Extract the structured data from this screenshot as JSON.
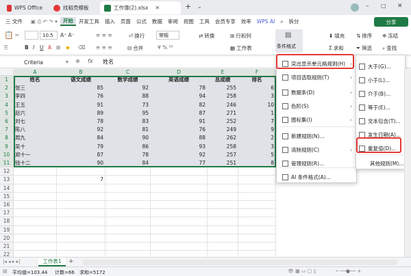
{
  "titlebar": {
    "tabs": [
      {
        "label": "WPS Office"
      },
      {
        "label": "找稻壳模板"
      },
      {
        "label": "工作簿(2).xlsx"
      }
    ],
    "new_tab": "+"
  },
  "menubar": {
    "file": "三 文件",
    "items": [
      "开始",
      "开发工具",
      "插入",
      "页面",
      "公式",
      "数据",
      "审阅",
      "视图",
      "工具",
      "会员专享",
      "效率"
    ],
    "wps_ai": "WPS AI",
    "split": "拆分",
    "share": "分享"
  },
  "ribbon": {
    "font_size": "10.5",
    "wrap": "换行",
    "merge": "合并",
    "number_format": "常规",
    "convert": "转换",
    "row_col": "行和列",
    "worksheet": "工作表",
    "cond_format": "条件格式",
    "fill": "填充",
    "sum": "求和",
    "sort": "排序",
    "filter": "筛选",
    "freeze": "冻结",
    "find": "查找"
  },
  "formula_bar": {
    "name_box": "Criteria",
    "fx": "fx",
    "value": "姓名"
  },
  "grid": {
    "columns": [
      "A",
      "B",
      "C",
      "D",
      "E",
      "F",
      "G"
    ],
    "headers": [
      "姓名",
      "语文成绩",
      "数学成绩",
      "英语成绩",
      "总成绩",
      "排名"
    ],
    "rows": [
      [
        "张三",
        "85",
        "92",
        "78",
        "255",
        "6"
      ],
      [
        "李四",
        "76",
        "88",
        "94",
        "258",
        "3"
      ],
      [
        "王五",
        "91",
        "73",
        "82",
        "246",
        "10"
      ],
      [
        "赵六",
        "89",
        "95",
        "87",
        "271",
        "1"
      ],
      [
        "刘七",
        "78",
        "83",
        "91",
        "252",
        "7"
      ],
      [
        "陈八",
        "92",
        "81",
        "76",
        "249",
        "9"
      ],
      [
        "周九",
        "84",
        "90",
        "88",
        "262",
        "2"
      ],
      [
        "吴十",
        "79",
        "86",
        "93",
        "258",
        "3"
      ],
      [
        "郑十一",
        "87",
        "78",
        "92",
        "257",
        "5"
      ],
      [
        "钱十二",
        "90",
        "84",
        "77",
        "251",
        "8"
      ]
    ],
    "row_numbers": [
      "1",
      "2",
      "3",
      "4",
      "5",
      "6",
      "7",
      "8",
      "9",
      "10",
      "11",
      "12",
      "13",
      "14",
      "15",
      "16",
      "17",
      "18",
      "19",
      "20",
      "21",
      "22"
    ],
    "b13_value": "7"
  },
  "cond_menu": {
    "items": [
      {
        "label": "突出显示单元格规则(H)",
        "submenu": true
      },
      {
        "label": "项目选取规则(T)",
        "submenu": true
      },
      {
        "label": "数据条(D)",
        "submenu": true
      },
      {
        "label": "色阶(S)",
        "submenu": true
      },
      {
        "label": "图标集(I)",
        "submenu": true
      },
      {
        "label": "新建规则(N)...",
        "submenu": false
      },
      {
        "label": "清除规则(C)",
        "submenu": true
      },
      {
        "label": "管理规则(R)...",
        "submenu": false
      },
      {
        "label": "AI 条件格式(A)...",
        "submenu": false
      }
    ]
  },
  "highlight_menu": {
    "items": [
      "大于(G)...",
      "小于(L)...",
      "介于(B)...",
      "等于(E)...",
      "文本包含(T)...",
      "发生日期(A)...",
      "重复值(D)...",
      "其他规则(M)..."
    ]
  },
  "sheetbar": {
    "sheet_tab": "工作表1",
    "add": "+"
  },
  "statusbar": {
    "average": "平均值=103.44",
    "count": "计数=66",
    "sum": "求和=5172"
  },
  "colors": {
    "accent": "#1f7a45",
    "highlight_border": "#e53935",
    "selection": "#dfe2e8"
  }
}
